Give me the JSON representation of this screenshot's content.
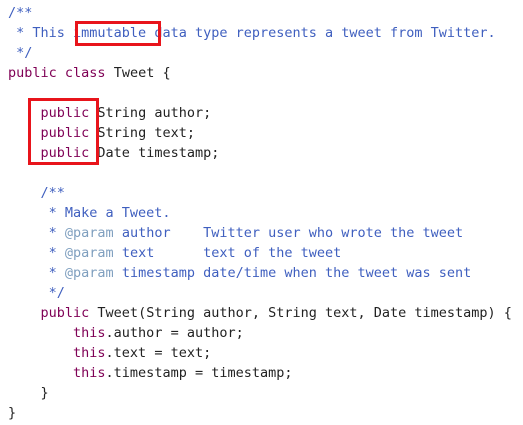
{
  "code": {
    "lines": [
      {
        "segments": [
          {
            "t": "/**",
            "c": "cm"
          }
        ]
      },
      {
        "segments": [
          {
            "t": " * This ",
            "c": "cm"
          },
          {
            "t": "immutable",
            "c": "cm"
          },
          {
            "t": " data type represents a tweet from Twitter.",
            "c": "cm"
          }
        ]
      },
      {
        "segments": [
          {
            "t": " */",
            "c": "cm"
          }
        ]
      },
      {
        "segments": [
          {
            "t": "public",
            "c": "kw"
          },
          {
            "t": " "
          },
          {
            "t": "class",
            "c": "kw"
          },
          {
            "t": " Tweet {"
          }
        ]
      },
      {
        "segments": []
      },
      {
        "segments": [
          {
            "t": "    "
          },
          {
            "t": "public",
            "c": "kw"
          },
          {
            "t": " String author;"
          }
        ]
      },
      {
        "segments": [
          {
            "t": "    "
          },
          {
            "t": "public",
            "c": "kw"
          },
          {
            "t": " String text;"
          }
        ]
      },
      {
        "segments": [
          {
            "t": "    "
          },
          {
            "t": "public",
            "c": "kw"
          },
          {
            "t": " Date timestamp;"
          }
        ]
      },
      {
        "segments": []
      },
      {
        "segments": [
          {
            "t": "    /**",
            "c": "cm"
          }
        ]
      },
      {
        "segments": [
          {
            "t": "     * Make a Tweet.",
            "c": "cm"
          }
        ]
      },
      {
        "segments": [
          {
            "t": "     * ",
            "c": "cm"
          },
          {
            "t": "@param",
            "c": "cm-tag"
          },
          {
            "t": " author    Twitter user who wrote the tweet",
            "c": "cm"
          }
        ]
      },
      {
        "segments": [
          {
            "t": "     * ",
            "c": "cm"
          },
          {
            "t": "@param",
            "c": "cm-tag"
          },
          {
            "t": " text      text of the tweet",
            "c": "cm"
          }
        ]
      },
      {
        "segments": [
          {
            "t": "     * ",
            "c": "cm"
          },
          {
            "t": "@param",
            "c": "cm-tag"
          },
          {
            "t": " timestamp date/time when the tweet was sent",
            "c": "cm"
          }
        ]
      },
      {
        "segments": [
          {
            "t": "     */",
            "c": "cm"
          }
        ]
      },
      {
        "segments": [
          {
            "t": "    "
          },
          {
            "t": "public",
            "c": "kw"
          },
          {
            "t": " Tweet(String author, String text, Date timestamp) {"
          }
        ]
      },
      {
        "segments": [
          {
            "t": "        "
          },
          {
            "t": "this",
            "c": "kw"
          },
          {
            "t": ".author = author;"
          }
        ]
      },
      {
        "segments": [
          {
            "t": "        "
          },
          {
            "t": "this",
            "c": "kw"
          },
          {
            "t": ".text = text;"
          }
        ]
      },
      {
        "segments": [
          {
            "t": "        "
          },
          {
            "t": "this",
            "c": "kw"
          },
          {
            "t": ".timestamp = timestamp;"
          }
        ]
      },
      {
        "segments": [
          {
            "t": "    }"
          }
        ]
      },
      {
        "segments": [
          {
            "t": "}"
          }
        ]
      }
    ]
  },
  "colors": {
    "comment": "#3f5fbf",
    "javadoc_tag": "#7f9fbf",
    "keyword": "#7f0055",
    "text": "#222222",
    "highlight_box": "#e8141b"
  }
}
